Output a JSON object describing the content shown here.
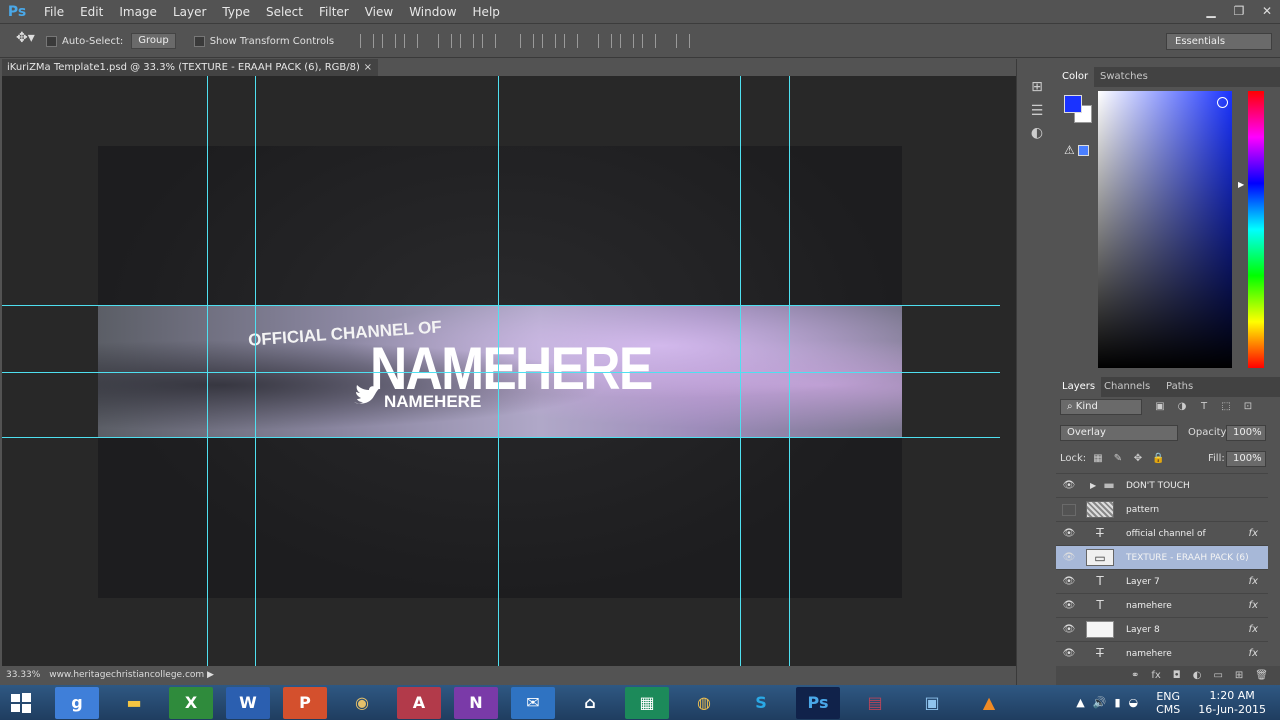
{
  "app": {
    "logo": "Ps"
  },
  "menu": [
    "File",
    "Edit",
    "Image",
    "Layer",
    "Type",
    "Select",
    "Filter",
    "View",
    "Window",
    "Help"
  ],
  "window_controls": {
    "minimize": "▁",
    "restore": "❐",
    "close": "✕"
  },
  "options": {
    "auto_select": "Auto-Select:",
    "auto_select_value": "Group",
    "show_transform": "Show Transform Controls",
    "workspace": "Essentials"
  },
  "document": {
    "tab_title": "iKuriZMa Template1.psd @ 33.3% (TEXTURE - ERAAH PACK (6), RGB/8)",
    "tab_close": "×",
    "banner_line1": "OFFICIAL CHANNEL OF",
    "banner_name": "NAMEHERE",
    "banner_handle": "NAMEHERE"
  },
  "status": {
    "zoom": "33.33%",
    "info": "www.heritagechristiancollege.com",
    "arrow": "▶"
  },
  "color_panel": {
    "tabs": [
      "Color",
      "Swatches"
    ],
    "foreground": "#1a33ff",
    "background": "#ffffff"
  },
  "layers_panel": {
    "tabs": [
      "Layers",
      "Channels",
      "Paths"
    ],
    "filter_kind": "Kind",
    "blend_mode": "Overlay",
    "opacity_label": "Opacity:",
    "opacity_value": "100%",
    "lock_label": "Lock:",
    "fill_label": "Fill:",
    "fill_value": "100%",
    "layers": [
      {
        "name": "DON'T TOUCH",
        "kind": "folder",
        "visible": true,
        "fx": false,
        "selected": false
      },
      {
        "name": "pattern",
        "kind": "pattern",
        "visible": false,
        "fx": false,
        "selected": false
      },
      {
        "name": "official channel of",
        "kind": "text-warp",
        "visible": true,
        "fx": true,
        "selected": false
      },
      {
        "name": "TEXTURE - ERAAH PACK (6)",
        "kind": "smart",
        "visible": true,
        "fx": false,
        "selected": true
      },
      {
        "name": "Layer 7",
        "kind": "text",
        "visible": true,
        "fx": true,
        "selected": false
      },
      {
        "name": "namehere",
        "kind": "text",
        "visible": true,
        "fx": true,
        "selected": false
      },
      {
        "name": "Layer 8",
        "kind": "white",
        "visible": true,
        "fx": true,
        "selected": false
      },
      {
        "name": "namehere",
        "kind": "text-warp",
        "visible": true,
        "fx": true,
        "selected": false
      }
    ]
  },
  "taskbar": {
    "apps": [
      "start",
      "chrome-g",
      "folder",
      "excel",
      "word",
      "powerpoint",
      "media",
      "access",
      "onenote",
      "outlook",
      "home",
      "publisher",
      "chrome",
      "skype",
      "photoshop",
      "winrar",
      "network",
      "vlc"
    ],
    "language": "ENG",
    "language_sub": "CMS",
    "time": "1:20 AM",
    "date": "16-Jun-2015"
  },
  "colors": {
    "guide": "#4fe0f0",
    "panel": "#535353",
    "canvas_bg": "#282828"
  }
}
